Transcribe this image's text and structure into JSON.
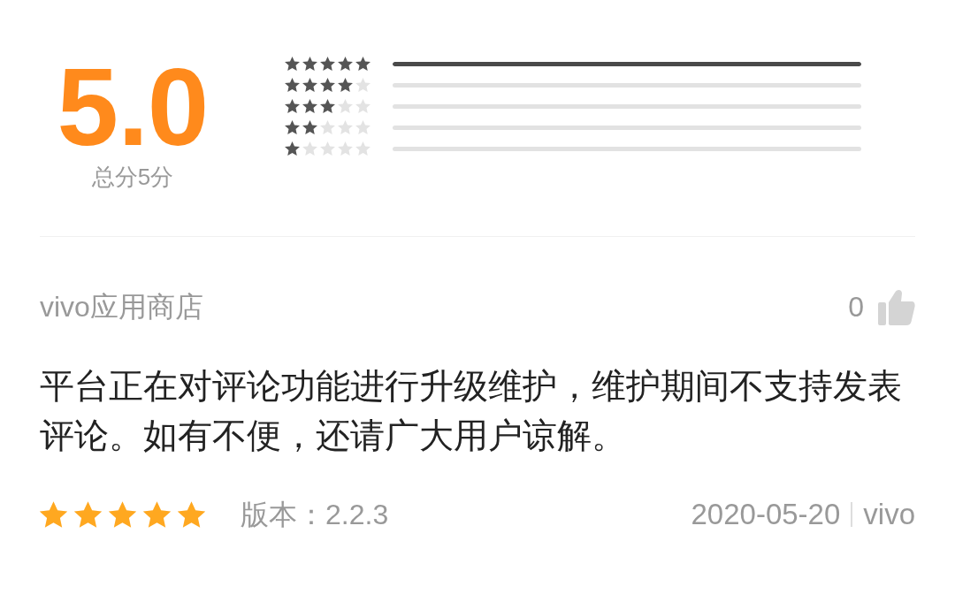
{
  "summary": {
    "score": "5.0",
    "caption": "总分5分"
  },
  "distribution": [
    {
      "stars": 5,
      "level": 1
    },
    {
      "stars": 4,
      "level": 0
    },
    {
      "stars": 3,
      "level": 0
    },
    {
      "stars": 2,
      "level": 0
    },
    {
      "stars": 1,
      "level": 0
    }
  ],
  "reviews": [
    {
      "author": "vivo应用商店",
      "likes": "0",
      "text": "平台正在对评论功能进行升级维护，维护期间不支持发表评论。如有不便，还请广大用户谅解。",
      "stars": 5,
      "version": "版本：2.2.3",
      "date": "2020-05-20",
      "source": "vivo"
    }
  ]
}
